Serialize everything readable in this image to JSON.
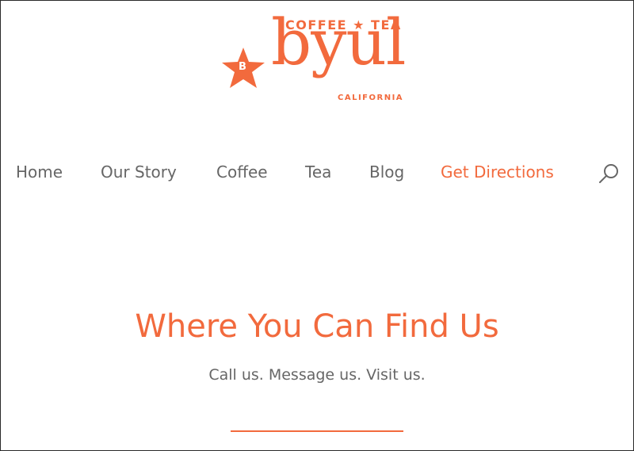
{
  "brand": {
    "top_text": "COFFEE ★ TEA",
    "word": "byul",
    "bottom_text": "CALIFORNIA",
    "star_letter": "B",
    "accent_color": "#f26a3d"
  },
  "nav": {
    "items": [
      {
        "label": "Home",
        "active": false
      },
      {
        "label": "Our Story",
        "active": false
      },
      {
        "label": "Coffee",
        "active": false
      },
      {
        "label": "Tea",
        "active": false
      },
      {
        "label": "Blog",
        "active": false
      },
      {
        "label": "Get Directions",
        "active": true
      }
    ],
    "search_icon": "search-icon"
  },
  "hero": {
    "title": "Where You Can Find Us",
    "subtitle": "Call us. Message us. Visit us."
  },
  "colors": {
    "text_gray": "#666666",
    "background": "#ffffff"
  }
}
